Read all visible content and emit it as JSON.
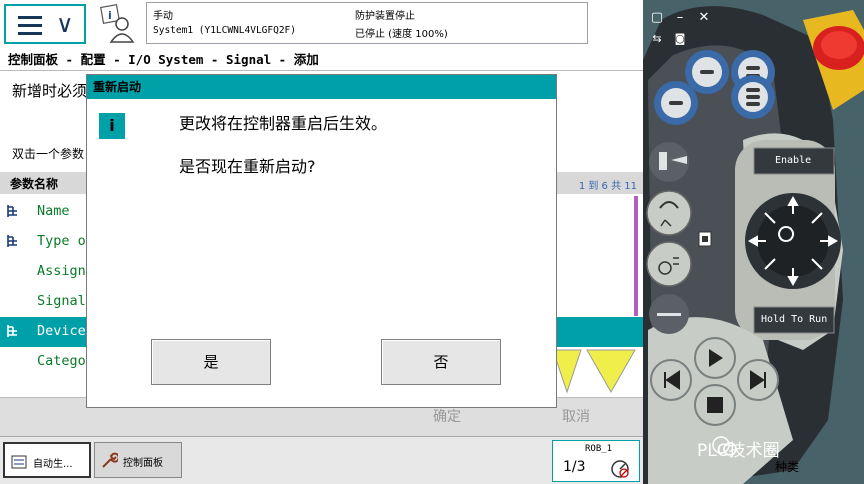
{
  "topbar": {
    "status_mode": "手动",
    "status_system": "System1 (Y1LCWNL4VLGFQ2F)",
    "status_guard": "防护装置停止",
    "status_state": "已停止 (速度 100%)"
  },
  "breadcrumb": "控制面板 - 配置 - I/O System - Signal - 添加",
  "main": {
    "new_prompt": "新增时必须",
    "dbl_hint": "双击一个参数",
    "param_header": "参数名称",
    "row_count": "1 到 6 共 11",
    "params": [
      "Name",
      "Type of",
      "Assign",
      "Signal",
      "Device",
      "Catego"
    ],
    "ok_label": "确定",
    "cancel_label": "取消"
  },
  "dialog": {
    "title": "重新启动",
    "message_1": "更改将在控制器重启后生效。",
    "message_2": "是否现在重新启动?",
    "yes_label": "是",
    "no_label": "否"
  },
  "taskbar": {
    "task_auto": "自动生...",
    "task_panel": "控制面板",
    "rob_label": "ROB_1",
    "rob_fraction": "1/3"
  },
  "pendant": {
    "enable_label": "Enable",
    "hold_label": "Hold To Run"
  },
  "watermark": "PLC技术圈",
  "background_text": "种类",
  "colors": {
    "accent": "#00a0a8",
    "pendant_body": "#3f5860",
    "button_blue": "#3a6aa8",
    "estop_red": "#d8201e"
  }
}
